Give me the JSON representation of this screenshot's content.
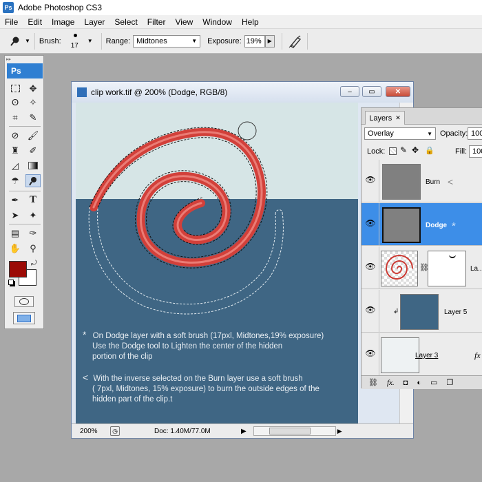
{
  "app": {
    "title": "Adobe Photoshop CS3",
    "logo": "Ps"
  },
  "menu": [
    "File",
    "Edit",
    "Image",
    "Layer",
    "Select",
    "Filter",
    "View",
    "Window",
    "Help"
  ],
  "options": {
    "brush_label": "Brush:",
    "brush_size": "17",
    "range_label": "Range:",
    "range_value": "Midtones",
    "exposure_label": "Exposure:",
    "exposure_value": "19%"
  },
  "toolbox": {
    "tab_label": "Ps",
    "foreground_color": "#9b0a05",
    "background_color": "#ffffff"
  },
  "document": {
    "title": "clip work.tif @ 200% (Dodge, RGB/8)",
    "zoom": "200%",
    "doc_size": "Doc: 1.40M/77.0M",
    "note1_lines": [
      "On Dodge layer with a soft brush (17pxl, Midtones,19% exposure)",
      "Use the Dodge tool to Lighten the center of the hidden",
      "portion of the clip"
    ],
    "note1_marker": "*",
    "note2_lines": [
      "With the inverse selected on the Burn layer use a soft brush",
      "( 7pxl, Midtones, 15% exposure) to burn the outside edges of the",
      "hidden part of the clip.t"
    ],
    "note2_marker": "<"
  },
  "layers_panel": {
    "tab_label": "Layers",
    "blend_mode": "Overlay",
    "opacity_label": "Opacity:",
    "opacity_value": "100",
    "lock_label": "Lock:",
    "fill_label": "Fill:",
    "fill_value": "100",
    "layers": [
      {
        "name": "Burn",
        "marker": "<",
        "selected": false
      },
      {
        "name": "Dodge",
        "marker": "*",
        "selected": true
      },
      {
        "name": "La...",
        "selected": false
      },
      {
        "name": "Layer 5",
        "selected": false
      },
      {
        "name": "Layer 3",
        "selected": false
      }
    ]
  }
}
